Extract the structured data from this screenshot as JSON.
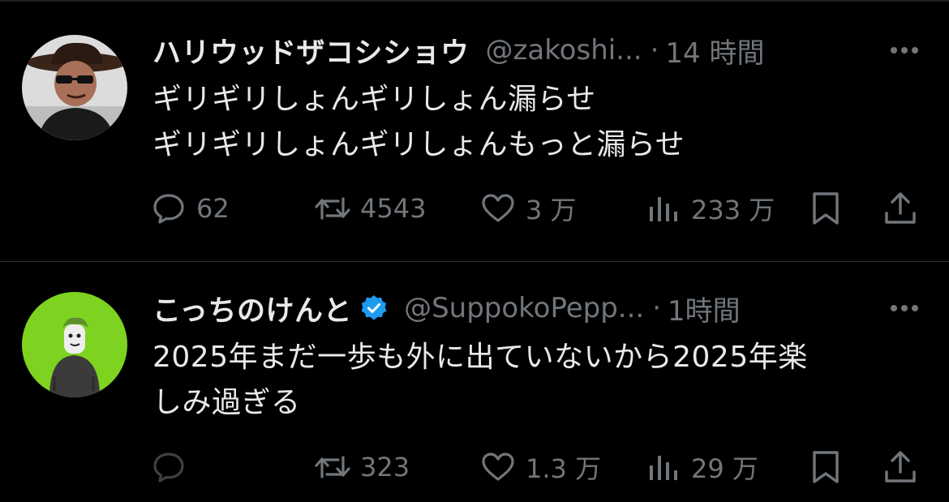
{
  "theme": {
    "background": "#000000",
    "text_primary": "#e7e9ea",
    "text_secondary": "#71767b",
    "divider": "#2f3336",
    "verified_badge": "#1d9bf0",
    "avatar_2_background": "#7ed321"
  },
  "tweets": [
    {
      "avatar_icon": "person-with-cowboy-hat-avatar",
      "display_name": "ハリウッドザコシショウ",
      "verified": false,
      "handle": "@zakoshi...",
      "separator": "·",
      "time": "14 時間",
      "body_lines": [
        "ギリギリしょんギリしょん漏らせ",
        "ギリギリしょんギリしょんもっと漏らせ"
      ],
      "actions": {
        "reply_count": "62",
        "repost_count": "4543",
        "like_count": "3 万",
        "view_count": "233 万"
      }
    },
    {
      "avatar_icon": "illustrated-person-avatar",
      "display_name": "こっちのけんと",
      "verified": true,
      "handle": "@SuppokoPepp...",
      "separator": "·",
      "time": "1時間",
      "body_lines": [
        "2025年まだ一歩も外に出ていないから2025年楽",
        "しみ過ぎる"
      ],
      "actions": {
        "reply_count": "",
        "repost_count": "323",
        "like_count": "1.3 万",
        "view_count": "29 万"
      }
    }
  ],
  "icons": {
    "more": "more-options-icon",
    "reply": "reply-icon",
    "repost": "repost-icon",
    "like": "like-icon",
    "views": "views-icon",
    "bookmark": "bookmark-icon",
    "share": "share-icon",
    "verified": "verified-badge-icon"
  }
}
